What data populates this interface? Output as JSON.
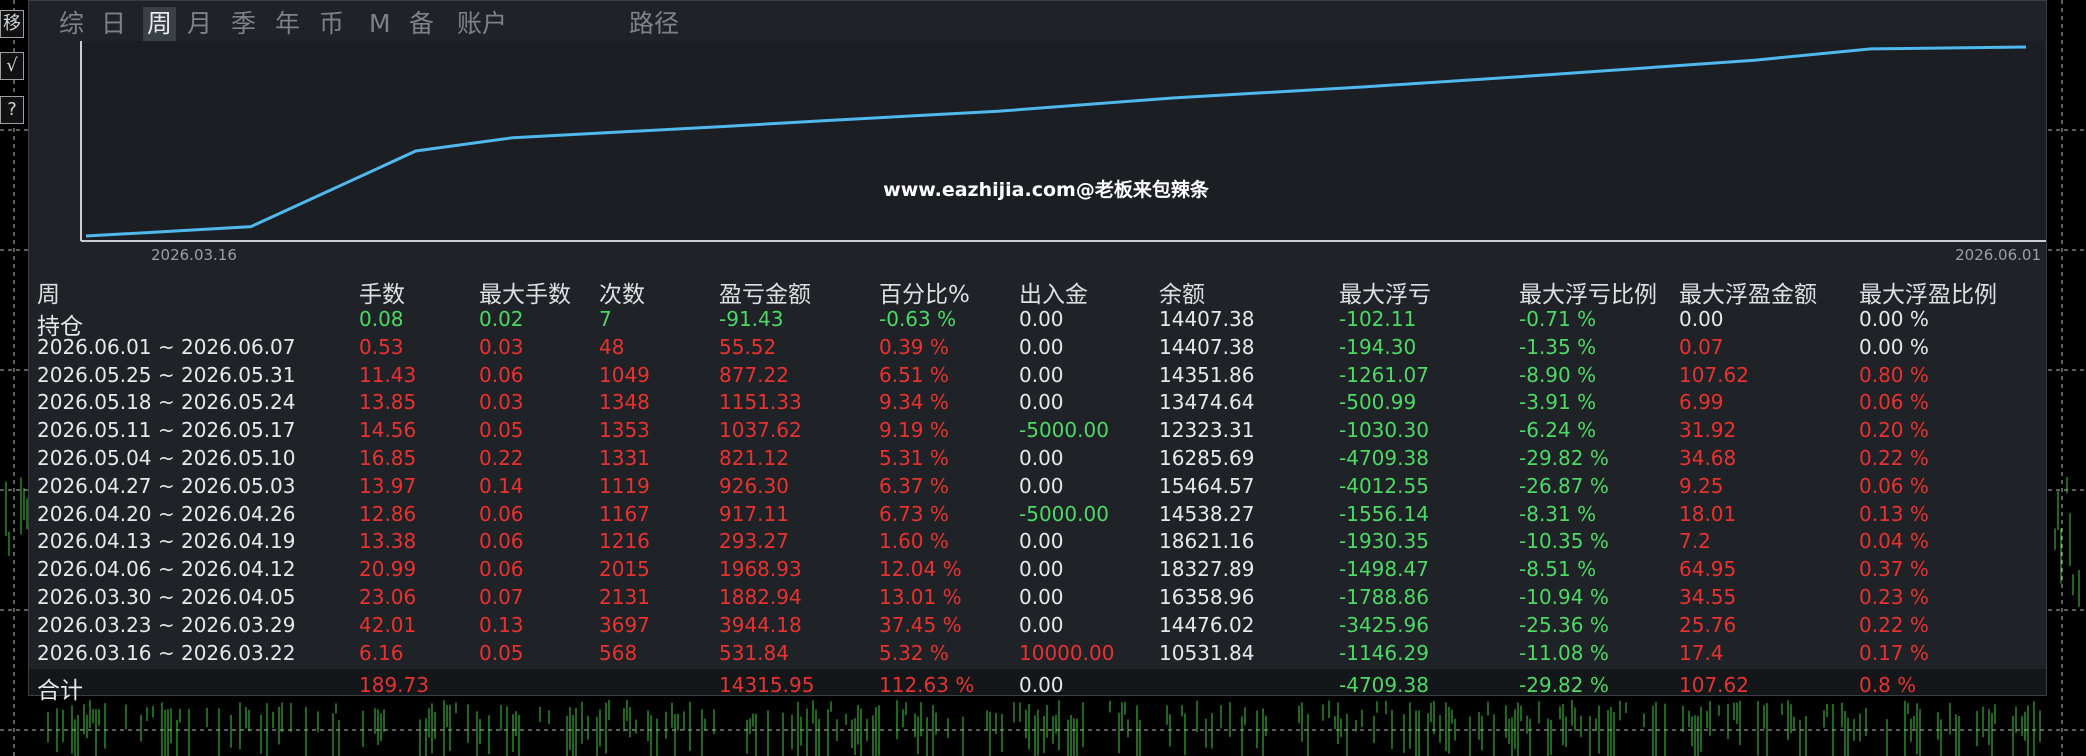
{
  "toolbar_left": {
    "glyphs": [
      "移",
      "√",
      "?"
    ]
  },
  "tabs": [
    {
      "label": "综",
      "active": false
    },
    {
      "label": "日",
      "active": false
    },
    {
      "label": "周",
      "active": true
    },
    {
      "label": "月",
      "active": false
    },
    {
      "label": "季",
      "active": false
    },
    {
      "label": "年",
      "active": false
    },
    {
      "label": "币",
      "active": false
    },
    {
      "label": "M",
      "active": false
    },
    {
      "label": "备",
      "active": false
    },
    {
      "label": "账户",
      "active": false
    },
    {
      "label": "路径",
      "active": false
    }
  ],
  "chart": {
    "watermark": "www.eazhijia.com@老板来包辣条",
    "x_start_label": "2026.03.16",
    "x_end_label": "2026.06.01",
    "line_color": "#4fb8ec"
  },
  "chart_data": {
    "type": "line",
    "x": [
      "2026.03.16",
      "2026.06.01"
    ],
    "y_points": [
      0,
      0.02,
      0.05,
      0.45,
      0.52,
      0.58,
      0.61,
      0.66,
      0.73,
      0.79,
      0.85,
      0.93,
      0.99,
      1.0
    ],
    "ylim": [
      0,
      1
    ],
    "grid": false,
    "title": "",
    "xlabel": "",
    "ylabel": ""
  },
  "table": {
    "headers": [
      "周",
      "手数",
      "最大手数",
      "次数",
      "盈亏金额",
      "百分比%",
      "出入金",
      "余额",
      "最大浮亏",
      "最大浮亏比例",
      "最大浮盈金额",
      "最大浮盈比例"
    ],
    "rows": [
      {
        "label": "持仓",
        "cells": [
          "0.08",
          "0.02",
          "7",
          "-91.43",
          "-0.63 %",
          "0.00",
          "14407.38",
          "-102.11",
          "-0.71 %",
          "0.00",
          "0.00 %"
        ],
        "colors": [
          "green",
          "green",
          "green",
          "green",
          "green",
          "white",
          "white",
          "green",
          "green",
          "white",
          "white"
        ]
      },
      {
        "label": "2026.06.01 ~ 2026.06.07",
        "cells": [
          "0.53",
          "0.03",
          "48",
          "55.52",
          "0.39 %",
          "0.00",
          "14407.38",
          "-194.30",
          "-1.35 %",
          "0.07",
          "0.00 %"
        ],
        "colors": [
          "red",
          "red",
          "red",
          "red",
          "red",
          "white",
          "white",
          "green",
          "green",
          "red",
          "white"
        ]
      },
      {
        "label": "2026.05.25 ~ 2026.05.31",
        "cells": [
          "11.43",
          "0.06",
          "1049",
          "877.22",
          "6.51 %",
          "0.00",
          "14351.86",
          "-1261.07",
          "-8.90 %",
          "107.62",
          "0.80 %"
        ],
        "colors": [
          "red",
          "red",
          "red",
          "red",
          "red",
          "white",
          "white",
          "green",
          "green",
          "red",
          "red"
        ]
      },
      {
        "label": "2026.05.18 ~ 2026.05.24",
        "cells": [
          "13.85",
          "0.03",
          "1348",
          "1151.33",
          "9.34 %",
          "0.00",
          "13474.64",
          "-500.99",
          "-3.91 %",
          "6.99",
          "0.06 %"
        ],
        "colors": [
          "red",
          "red",
          "red",
          "red",
          "red",
          "white",
          "white",
          "green",
          "green",
          "red",
          "red"
        ]
      },
      {
        "label": "2026.05.11 ~ 2026.05.17",
        "cells": [
          "14.56",
          "0.05",
          "1353",
          "1037.62",
          "9.19 %",
          "-5000.00",
          "12323.31",
          "-1030.30",
          "-6.24 %",
          "31.92",
          "0.20 %"
        ],
        "colors": [
          "red",
          "red",
          "red",
          "red",
          "red",
          "green",
          "white",
          "green",
          "green",
          "red",
          "red"
        ]
      },
      {
        "label": "2026.05.04 ~ 2026.05.10",
        "cells": [
          "16.85",
          "0.22",
          "1331",
          "821.12",
          "5.31 %",
          "0.00",
          "16285.69",
          "-4709.38",
          "-29.82 %",
          "34.68",
          "0.22 %"
        ],
        "colors": [
          "red",
          "red",
          "red",
          "red",
          "red",
          "white",
          "white",
          "green",
          "green",
          "red",
          "red"
        ]
      },
      {
        "label": "2026.04.27 ~ 2026.05.03",
        "cells": [
          "13.97",
          "0.14",
          "1119",
          "926.30",
          "6.37 %",
          "0.00",
          "15464.57",
          "-4012.55",
          "-26.87 %",
          "9.25",
          "0.06 %"
        ],
        "colors": [
          "red",
          "red",
          "red",
          "red",
          "red",
          "white",
          "white",
          "green",
          "green",
          "red",
          "red"
        ]
      },
      {
        "label": "2026.04.20 ~ 2026.04.26",
        "cells": [
          "12.86",
          "0.06",
          "1167",
          "917.11",
          "6.73 %",
          "-5000.00",
          "14538.27",
          "-1556.14",
          "-8.31 %",
          "18.01",
          "0.13 %"
        ],
        "colors": [
          "red",
          "red",
          "red",
          "red",
          "red",
          "green",
          "white",
          "green",
          "green",
          "red",
          "red"
        ]
      },
      {
        "label": "2026.04.13 ~ 2026.04.19",
        "cells": [
          "13.38",
          "0.06",
          "1216",
          "293.27",
          "1.60 %",
          "0.00",
          "18621.16",
          "-1930.35",
          "-10.35 %",
          "7.2",
          "0.04 %"
        ],
        "colors": [
          "red",
          "red",
          "red",
          "red",
          "red",
          "white",
          "white",
          "green",
          "green",
          "red",
          "red"
        ]
      },
      {
        "label": "2026.04.06 ~ 2026.04.12",
        "cells": [
          "20.99",
          "0.06",
          "2015",
          "1968.93",
          "12.04 %",
          "0.00",
          "18327.89",
          "-1498.47",
          "-8.51 %",
          "64.95",
          "0.37 %"
        ],
        "colors": [
          "red",
          "red",
          "red",
          "red",
          "red",
          "white",
          "white",
          "green",
          "green",
          "red",
          "red"
        ]
      },
      {
        "label": "2026.03.30 ~ 2026.04.05",
        "cells": [
          "23.06",
          "0.07",
          "2131",
          "1882.94",
          "13.01 %",
          "0.00",
          "16358.96",
          "-1788.86",
          "-10.94 %",
          "34.55",
          "0.23 %"
        ],
        "colors": [
          "red",
          "red",
          "red",
          "red",
          "red",
          "white",
          "white",
          "green",
          "green",
          "red",
          "red"
        ]
      },
      {
        "label": "2026.03.23 ~ 2026.03.29",
        "cells": [
          "42.01",
          "0.13",
          "3697",
          "3944.18",
          "37.45 %",
          "0.00",
          "14476.02",
          "-3425.96",
          "-25.36 %",
          "25.76",
          "0.22 %"
        ],
        "colors": [
          "red",
          "red",
          "red",
          "red",
          "red",
          "white",
          "white",
          "green",
          "green",
          "red",
          "red"
        ]
      },
      {
        "label": "2026.03.16 ~ 2026.03.22",
        "cells": [
          "6.16",
          "0.05",
          "568",
          "531.84",
          "5.32 %",
          "10000.00",
          "10531.84",
          "-1146.29",
          "-11.08 %",
          "17.4",
          "0.17 %"
        ],
        "colors": [
          "red",
          "red",
          "red",
          "red",
          "red",
          "red",
          "white",
          "green",
          "green",
          "red",
          "red"
        ]
      }
    ],
    "total": {
      "label": "合计",
      "cells": [
        "189.73",
        "",
        "",
        "14315.95",
        "112.63 %",
        "0.00",
        "",
        "-4709.38",
        "-29.82 %",
        "107.62",
        "0.8 %"
      ],
      "colors": [
        "red",
        "red",
        "red",
        "red",
        "red",
        "white",
        "white",
        "green",
        "green",
        "red",
        "red"
      ]
    }
  },
  "colors": {
    "red": "#e8322f",
    "green": "#4cd964",
    "white": "#e6e8ea",
    "panel_bg": "#1f2328"
  }
}
